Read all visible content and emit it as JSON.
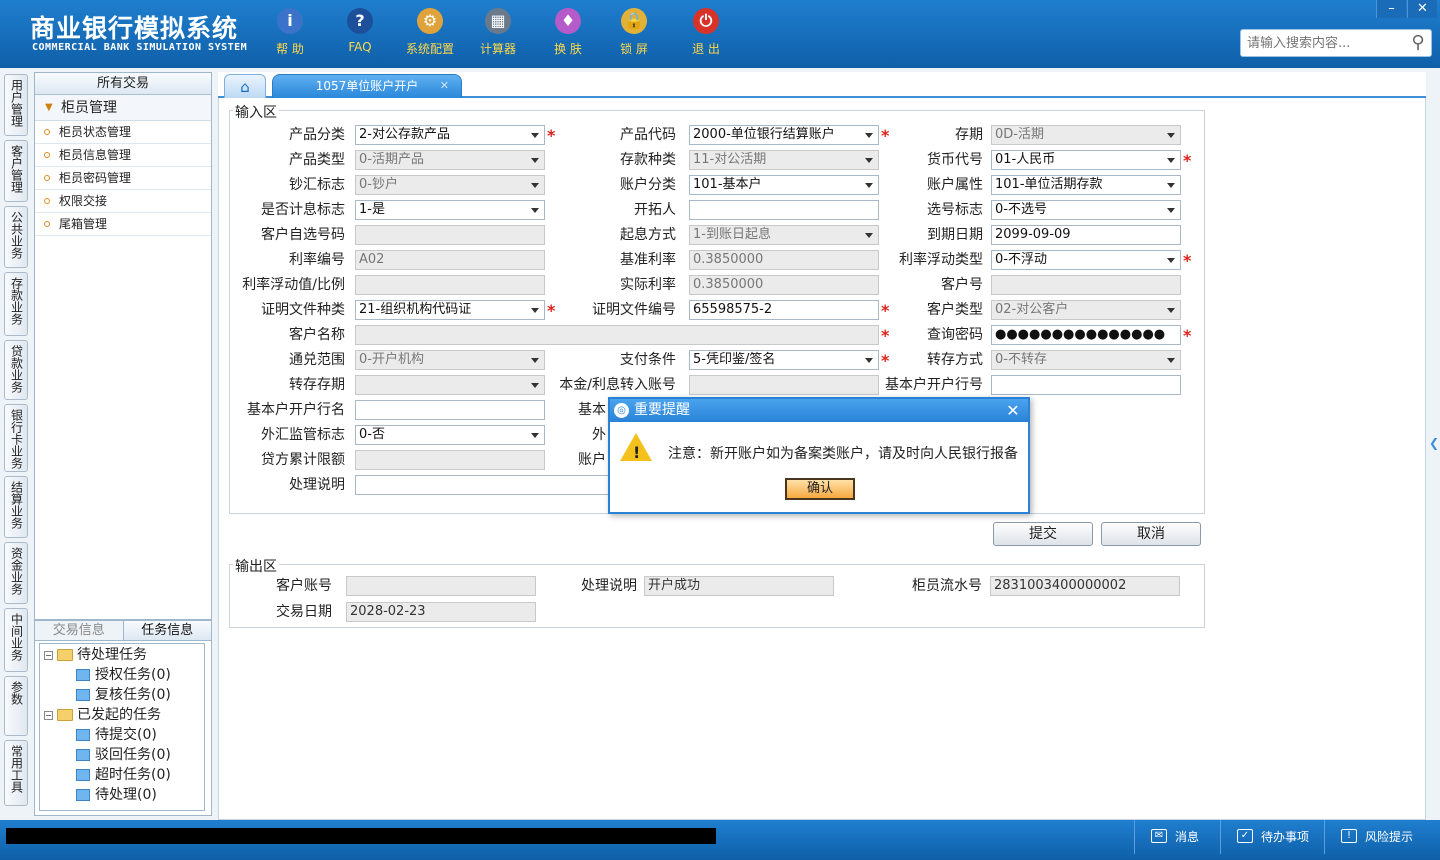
{
  "header": {
    "title_cn": "商业银行模拟系统",
    "title_en": "COMMERCIAL BANK SIMULATION SYSTEM",
    "toolbar": [
      {
        "label": "帮 助",
        "icon": "info-icon",
        "color": "#3a73c9",
        "glyph": "i"
      },
      {
        "label": "FAQ",
        "icon": "faq-icon",
        "color": "#1d4f9a",
        "glyph": "?"
      },
      {
        "label": "系统配置",
        "icon": "config-toolbox-icon",
        "color": "#e0a23a",
        "glyph": "⚙"
      },
      {
        "label": "计算器",
        "icon": "calculator-icon",
        "color": "#6a7a8a",
        "glyph": "▦"
      },
      {
        "label": "换 肤",
        "icon": "skin-shirt-icon",
        "color": "#b55bc9",
        "glyph": "♦"
      },
      {
        "label": "锁 屏",
        "icon": "lock-icon",
        "color": "#e2b13a",
        "glyph": "🔒"
      },
      {
        "label": "退 出",
        "icon": "power-icon",
        "color": "#d8332a",
        "glyph": "⏻"
      }
    ],
    "search_placeholder": "请输入搜索内容...",
    "window_controls": [
      "–",
      "✕"
    ]
  },
  "vertical_tabs": [
    "用户管理",
    "客户管理",
    "公共业务",
    "存款业务",
    "贷款业务",
    "银行卡业务",
    "结算业务",
    "资金业务",
    "中间业务",
    "参数",
    "常用工具"
  ],
  "left_panel": {
    "header": "所有交易",
    "group": "柜员管理",
    "items": [
      "柜员状态管理",
      "柜员信息管理",
      "柜员密码管理",
      "权限交接",
      "尾箱管理"
    ]
  },
  "task_panel": {
    "tabs": [
      "交易信息",
      "任务信息"
    ],
    "tree": [
      {
        "label": "待处理任务",
        "type": "folder"
      },
      {
        "label": "授权任务(0)",
        "type": "leaf"
      },
      {
        "label": "复核任务(0)",
        "type": "leaf"
      },
      {
        "label": "已发起的任务",
        "type": "folder"
      },
      {
        "label": "待提交(0)",
        "type": "leaf"
      },
      {
        "label": "驳回任务(0)",
        "type": "leaf"
      },
      {
        "label": "超时任务(0)",
        "type": "leaf"
      },
      {
        "label": "待处理(0)",
        "type": "leaf"
      }
    ]
  },
  "tabs": {
    "home_glyph": "⌂",
    "active": "1057单位账户开户",
    "close_glyph": "✕"
  },
  "form": {
    "input_section": "输入区",
    "output_section": "输出区",
    "fields": [
      {
        "label": "产品分类",
        "value": "2-对公存款产品",
        "kind": "dd",
        "req": true
      },
      {
        "label": "产品代码",
        "value": "2000-单位银行结算账户",
        "kind": "dd",
        "req": true
      },
      {
        "label": "存期",
        "value": "0D-活期",
        "kind": "ro-dd",
        "req": false
      },
      {
        "label": "产品类型",
        "value": "0-活期产品",
        "kind": "ro-dd",
        "req": false
      },
      {
        "label": "存款种类",
        "value": "11-对公活期",
        "kind": "ro-dd",
        "req": false
      },
      {
        "label": "货币代号",
        "value": "01-人民币",
        "kind": "dd",
        "req": true
      },
      {
        "label": "钞汇标志",
        "value": "0-钞户",
        "kind": "ro-dd",
        "req": false
      },
      {
        "label": "账户分类",
        "value": "101-基本户",
        "kind": "dd",
        "req": false
      },
      {
        "label": "账户属性",
        "value": "101-单位活期存款",
        "kind": "dd",
        "req": false
      },
      {
        "label": "是否计息标志",
        "value": "1-是",
        "kind": "dd",
        "req": false
      },
      {
        "label": "开拓人",
        "value": "",
        "kind": "text",
        "req": false
      },
      {
        "label": "选号标志",
        "value": "0-不选号",
        "kind": "dd",
        "req": false
      },
      {
        "label": "客户自选号码",
        "value": "",
        "kind": "ro",
        "req": false
      },
      {
        "label": "起息方式",
        "value": "1-到账日起息",
        "kind": "ro-dd",
        "req": false
      },
      {
        "label": "到期日期",
        "value": "2099-09-09",
        "kind": "text",
        "req": false
      },
      {
        "label": "利率编号",
        "value": "A02",
        "kind": "ro",
        "req": false
      },
      {
        "label": "基准利率",
        "value": "0.3850000",
        "kind": "ro",
        "req": false
      },
      {
        "label": "利率浮动类型",
        "value": "0-不浮动",
        "kind": "dd",
        "req": true
      },
      {
        "label": "利率浮动值/比例",
        "value": "",
        "kind": "ro",
        "req": false
      },
      {
        "label": "实际利率",
        "value": "0.3850000",
        "kind": "ro",
        "req": false
      },
      {
        "label": "客户号",
        "value": "",
        "kind": "blur",
        "req": false
      },
      {
        "label": "证明文件种类",
        "value": "21-组织机构代码证",
        "kind": "dd",
        "req": true
      },
      {
        "label": "证明文件编号",
        "value": "65598575-2",
        "kind": "text",
        "req": true
      },
      {
        "label": "客户类型",
        "value": "02-对公客户",
        "kind": "ro-dd",
        "req": false
      },
      {
        "label": "客户名称",
        "value": "",
        "kind": "blur",
        "req": true
      },
      {
        "label": "查询密码",
        "value": "●●●●●●●●●●●●●●●",
        "kind": "text",
        "req": true
      },
      {
        "label": "通兑范围",
        "value": "0-开户机构",
        "kind": "ro-dd",
        "req": false
      },
      {
        "label": "支付条件",
        "value": "5-凭印鉴/签名",
        "kind": "dd",
        "req": true
      },
      {
        "label": "转存方式",
        "value": "0-不转存",
        "kind": "ro-dd",
        "req": false
      },
      {
        "label": "转存存期",
        "value": "",
        "kind": "ro-dd",
        "req": false
      },
      {
        "label": "本金/利息转入账号",
        "value": "",
        "kind": "ro",
        "req": false
      },
      {
        "label": "基本户开户行号",
        "value": "",
        "kind": "text",
        "req": false
      },
      {
        "label": "基本户开户行名",
        "value": "",
        "kind": "text",
        "req": false
      },
      {
        "label": "基本",
        "value": "",
        "kind": "text",
        "req": false
      },
      {
        "label": "外汇监管标志",
        "value": "0-否",
        "kind": "dd",
        "req": false
      },
      {
        "label": "外",
        "value": "",
        "kind": "ro",
        "req": false
      },
      {
        "label": "贷方累计限额",
        "value": "",
        "kind": "ro",
        "req": false
      },
      {
        "label": "账户",
        "value": "",
        "kind": "text",
        "req": false
      },
      {
        "label": "处理说明",
        "value": "",
        "kind": "text",
        "req": false
      }
    ],
    "submit": "提交",
    "cancel": "取消",
    "output": [
      {
        "label": "客户账号",
        "value": ""
      },
      {
        "label": "处理说明",
        "value": "开户成功"
      },
      {
        "label": "柜员流水号",
        "value": "2831003400000002"
      },
      {
        "label": "交易日期",
        "value": "2028-02-23"
      }
    ]
  },
  "dialog": {
    "title": "重要提醒",
    "message": "注意：新开账户如为备案类账户，请及时向人民银行报备",
    "ok": "确认",
    "close_glyph": "✕",
    "warn_glyph": "!"
  },
  "statusbar": {
    "buttons": [
      {
        "label": "消息",
        "icon": "message-icon",
        "glyph": "✉"
      },
      {
        "label": "待办事项",
        "icon": "todo-check-icon",
        "glyph": "✓"
      },
      {
        "label": "风险提示",
        "icon": "risk-chat-icon",
        "glyph": "!"
      }
    ]
  },
  "colors": {
    "brand_blue": "#1f7fcf",
    "required": "#e0221b",
    "dialog_border": "#2a82d6"
  }
}
